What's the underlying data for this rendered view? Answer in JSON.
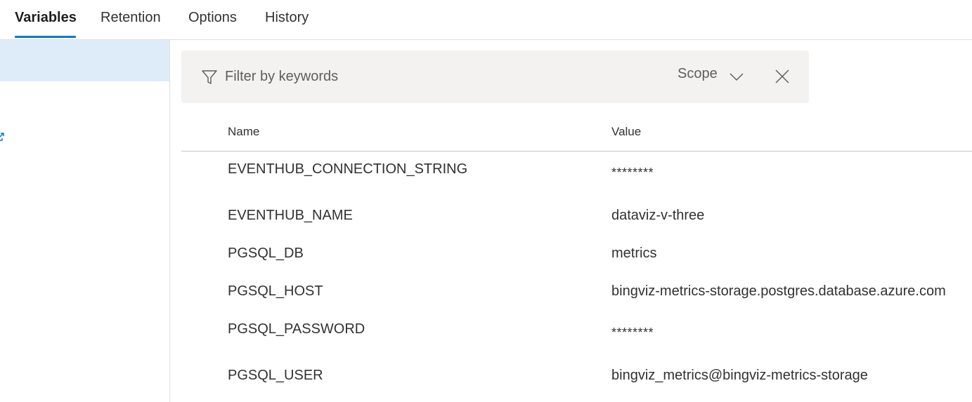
{
  "tabs": [
    {
      "label": "Variables",
      "active": true
    },
    {
      "label": "Retention",
      "active": false
    },
    {
      "label": "Options",
      "active": false
    },
    {
      "label": "History",
      "active": false
    }
  ],
  "filter": {
    "placeholder": "Filter by keywords",
    "scope_label": "Scope"
  },
  "table": {
    "columns": {
      "name": "Name",
      "value": "Value"
    },
    "rows": [
      {
        "name": "EVENTHUB_CONNECTION_STRING",
        "value": "********",
        "secret": true
      },
      {
        "name": "EVENTHUB_NAME",
        "value": "dataviz-v-three",
        "secret": false
      },
      {
        "name": "PGSQL_DB",
        "value": "metrics",
        "secret": false
      },
      {
        "name": "PGSQL_HOST",
        "value": "bingviz-metrics-storage.postgres.database.azure.com",
        "secret": false
      },
      {
        "name": "PGSQL_PASSWORD",
        "value": "********",
        "secret": true
      },
      {
        "name": "PGSQL_USER",
        "value": "bingviz_metrics@bingviz-metrics-storage",
        "secret": false
      }
    ]
  },
  "colors": {
    "accent": "#0078d4",
    "selected_bg": "#deecf9",
    "filter_bg": "#f3f2f1"
  },
  "icons": {
    "filter": "filter-icon",
    "scope": "chevron-down-icon",
    "clear": "close-icon",
    "sidebar_link": "external-link-icon"
  }
}
